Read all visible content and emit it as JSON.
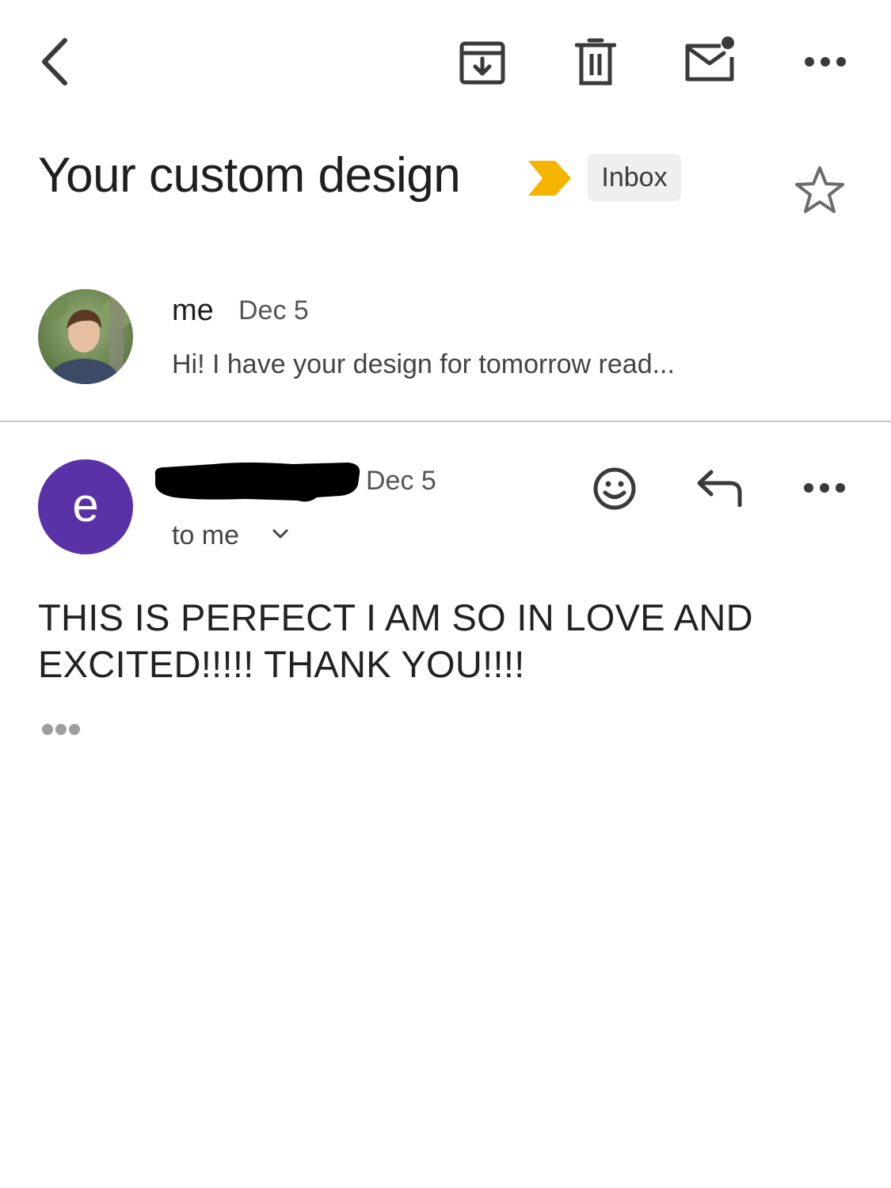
{
  "toolbar": {
    "back_icon": "chevron-left-icon",
    "archive_icon": "archive-icon",
    "delete_icon": "trash-icon",
    "mark_unread_icon": "mail-unread-icon",
    "more_icon": "more-horizontal-icon"
  },
  "thread": {
    "subject": "Your custom design",
    "importance_color": "#F4B400",
    "label": "Inbox",
    "star_icon": "star-outline-icon"
  },
  "messages": [
    {
      "sender": "me",
      "date": "Dec 5",
      "snippet": "Hi! I have your design for tomorrow read...",
      "avatar": "profile-photo"
    },
    {
      "avatar_letter": "e",
      "avatar_color": "#5A32A8",
      "date": "Dec 5",
      "recipients": "to me",
      "body": "THIS IS PERFECT I AM SO IN LOVE AND EXCITED!!!!! THANK YOU!!!!",
      "actions": [
        "emoji-reaction-icon",
        "reply-icon",
        "more-horizontal-icon"
      ]
    }
  ]
}
